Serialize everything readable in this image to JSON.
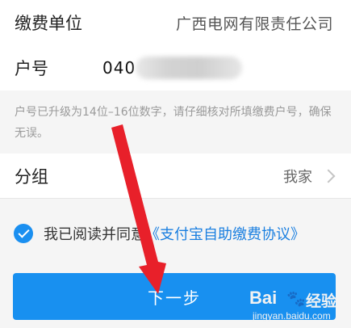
{
  "payee": {
    "label": "缴费单位",
    "value": "广西电网有限责任公司"
  },
  "account": {
    "label": "户号",
    "value_visible": "040"
  },
  "hint": "户号已升级为14位–16位数字，请仔细核对所填缴费户号，确保无误。",
  "group": {
    "label": "分组",
    "value": "我家"
  },
  "agreement": {
    "prefix": "我已阅读并同意",
    "link": "《支付宝自助缴费协议》",
    "checked": true
  },
  "next_button": "下一步",
  "watermark": {
    "brand": "Bai",
    "paw": "🐾",
    "cn": "经验",
    "url": "jingyan.baidu.com"
  },
  "colors": {
    "accent": "#1890f0",
    "link": "#1a7fe0",
    "annotation_arrow": "#e8202a"
  }
}
